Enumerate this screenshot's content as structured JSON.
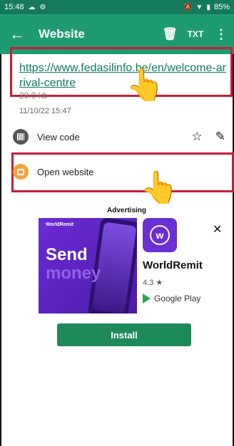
{
  "statusbar": {
    "time": "15:48",
    "battery": "85%"
  },
  "toolbar": {
    "title": "Website",
    "txt_label": "TXT"
  },
  "entry": {
    "url": "https://www.fedasilinfo.be/en/welcome-arrival-centre",
    "size": "28.0 kb",
    "date": "11/10/22 15:47"
  },
  "actions": {
    "view_code": "View code",
    "open_website": "Open website"
  },
  "ad": {
    "label": "Advertising",
    "brand": "WorldRemit",
    "headline_1": "Send",
    "headline_2": "money",
    "app_name": "WorldRemit",
    "rating": "4.3 ★",
    "store": "Google Play",
    "install": "Install",
    "logo_letter": "w"
  },
  "colors": {
    "statusbar": "#157a5c",
    "toolbar": "#1f9b72",
    "link": "#0e7a5c",
    "highlight_box": "#c81d3a",
    "install_button": "#1e8a5a"
  }
}
